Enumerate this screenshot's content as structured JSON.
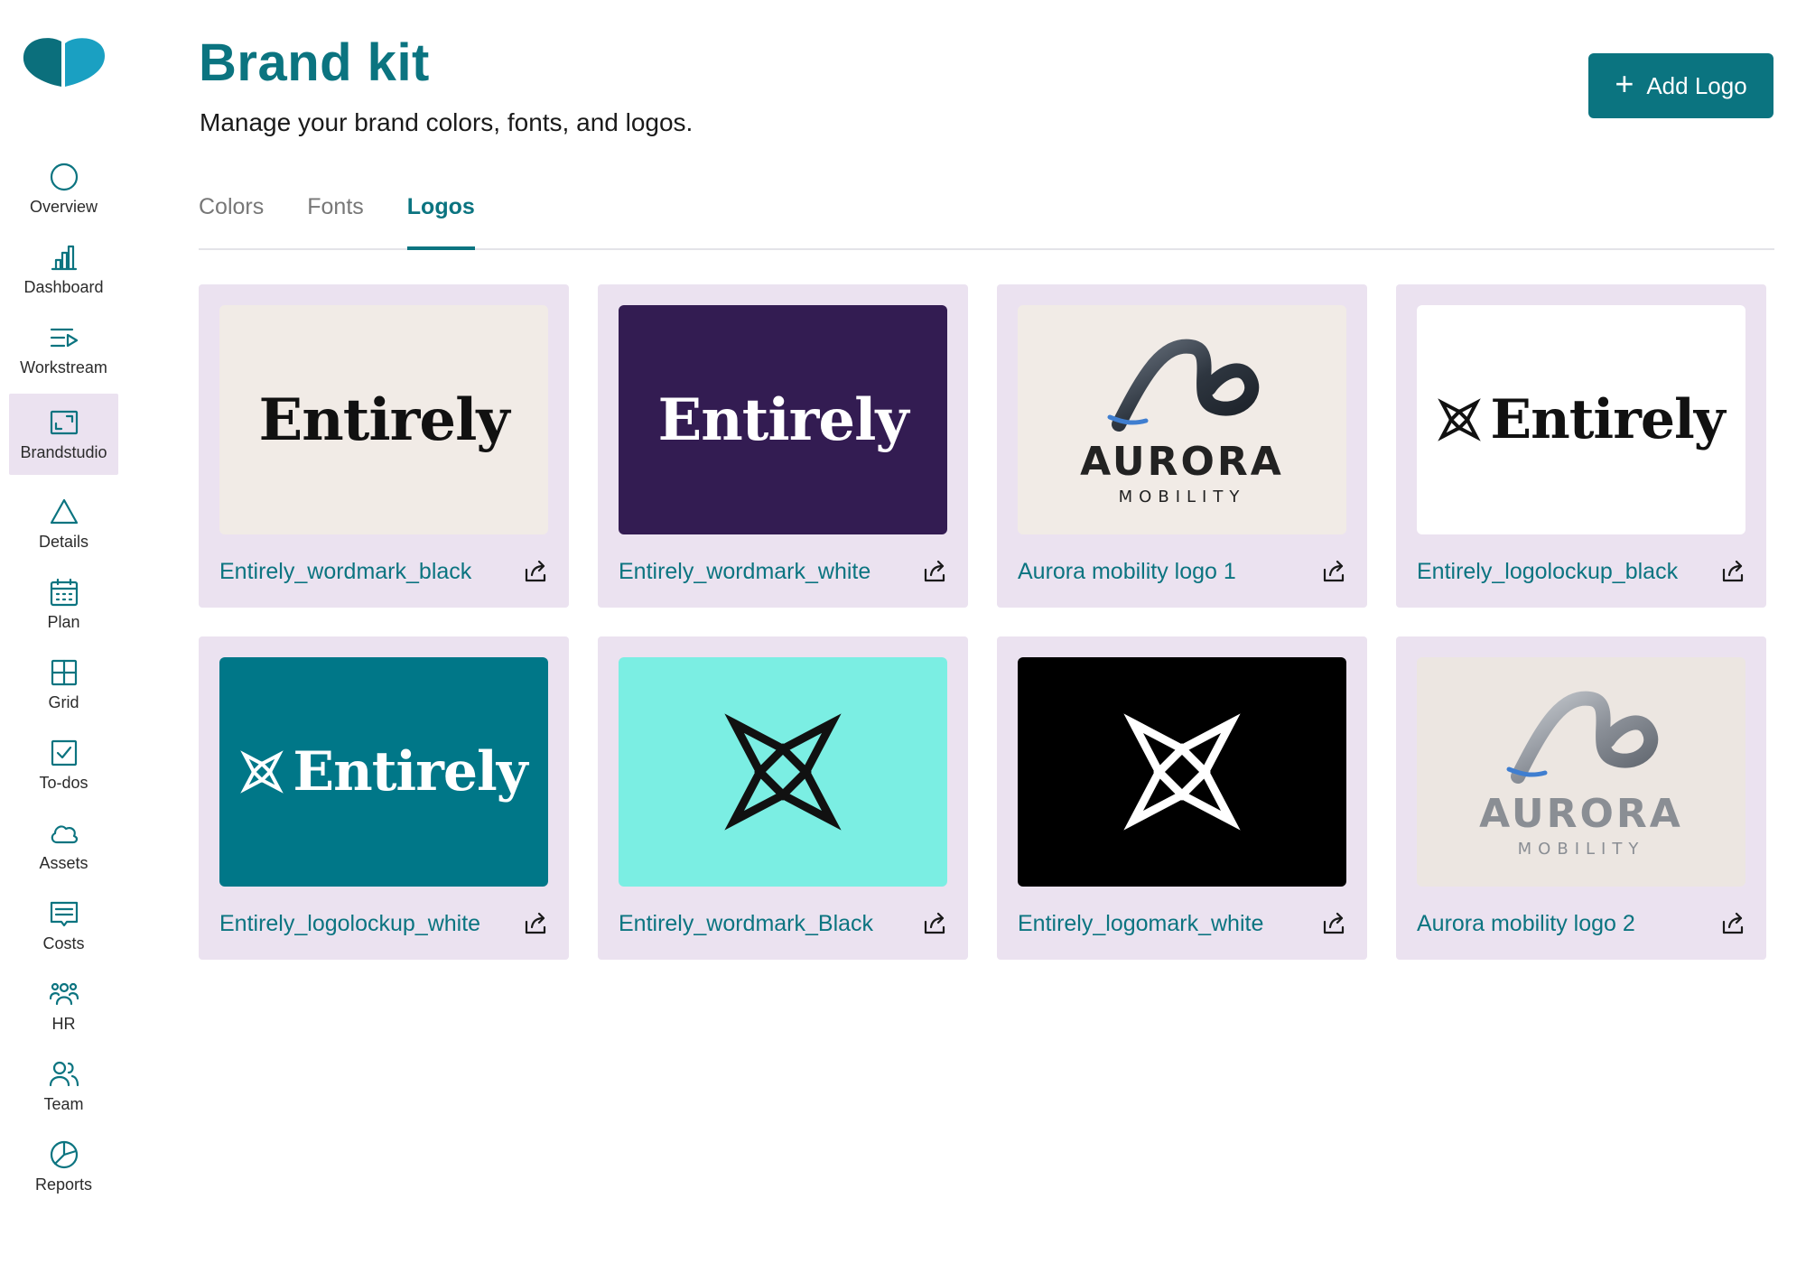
{
  "colors": {
    "accent": "#0b7480",
    "card_bg": "#ebe2f0",
    "purple_bg": "#331c52",
    "mint_bg": "#7beee3",
    "cream_bg": "#f1ebe6"
  },
  "sidebar": {
    "items": [
      {
        "label": "Overview",
        "icon": "circle-icon"
      },
      {
        "label": "Dashboard",
        "icon": "bar-chart-icon"
      },
      {
        "label": "Workstream",
        "icon": "list-play-icon"
      },
      {
        "label": "Brandstudio",
        "icon": "frame-icon"
      },
      {
        "label": "Details",
        "icon": "triangle-icon"
      },
      {
        "label": "Plan",
        "icon": "calendar-icon"
      },
      {
        "label": "Grid",
        "icon": "grid-icon"
      },
      {
        "label": "To-dos",
        "icon": "checkbox-icon"
      },
      {
        "label": "Assets",
        "icon": "cloud-icon"
      },
      {
        "label": "Costs",
        "icon": "receipt-icon"
      },
      {
        "label": "HR",
        "icon": "group-icon"
      },
      {
        "label": "Team",
        "icon": "team-icon"
      },
      {
        "label": "Reports",
        "icon": "pie-chart-icon"
      }
    ]
  },
  "header": {
    "title": "Brand kit",
    "subtitle": "Manage your brand colors, fonts, and logos.",
    "add_button": "Add Logo"
  },
  "tabs": [
    {
      "label": "Colors"
    },
    {
      "label": "Fonts"
    },
    {
      "label": "Logos",
      "active": true
    }
  ],
  "logos": [
    {
      "name": "Entirely_wordmark_black",
      "preview_text": "Entirely"
    },
    {
      "name": "Entirely_wordmark_white",
      "preview_text": "Entirely"
    },
    {
      "name": "Aurora mobility logo 1",
      "preview_text": "AURORA",
      "preview_sub": "MOBILITY"
    },
    {
      "name": "Entirely_logolockup_black",
      "preview_text": "Entirely"
    },
    {
      "name": "Entirely_logolockup_white",
      "preview_text": "Entirely"
    },
    {
      "name": "Entirely_wordmark_Black"
    },
    {
      "name": "Entirely_logomark_white"
    },
    {
      "name": "Aurora mobility logo 2",
      "preview_text": "AURORA",
      "preview_sub": "MOBILITY"
    }
  ]
}
